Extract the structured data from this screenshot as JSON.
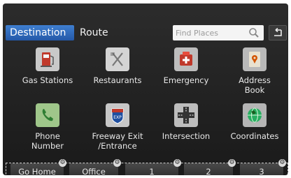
{
  "tabs": {
    "destination": "Destination",
    "route": "Route"
  },
  "search": {
    "placeholder": "Find Places"
  },
  "categories": [
    {
      "label": "Gas Stations",
      "icon": "gas-pump-icon"
    },
    {
      "label": "Restaurants",
      "icon": "fork-knife-icon"
    },
    {
      "label": "Emergency",
      "icon": "emergency-icon"
    },
    {
      "label": "Address\nBook",
      "icon": "address-book-icon"
    },
    {
      "label": "Phone\nNumber",
      "icon": "phone-icon"
    },
    {
      "label": "Freeway Exit\n/Entrance",
      "icon": "freeway-exit-icon"
    },
    {
      "label": "Intersection",
      "icon": "intersection-icon"
    },
    {
      "label": "Coordinates",
      "icon": "globe-icon"
    }
  ],
  "quick_buttons": [
    "Go Home",
    "Office",
    "1",
    "2",
    "3"
  ],
  "colors": {
    "accent": "#2e6bc0",
    "background": "#222222"
  }
}
